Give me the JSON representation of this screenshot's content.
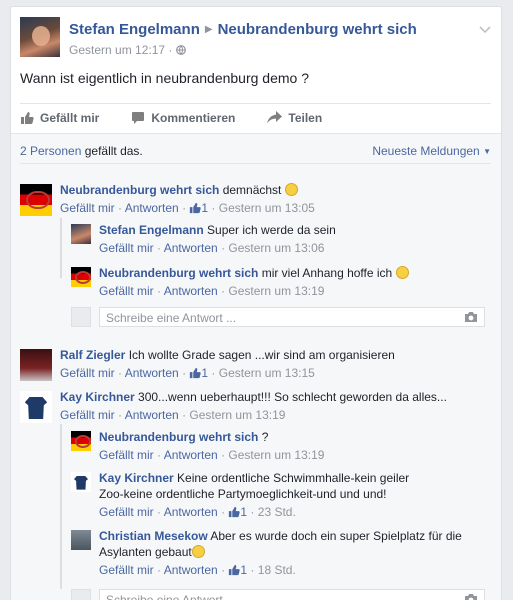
{
  "post": {
    "author": "Stefan Engelmann",
    "group": "Neubrandenburg wehrt sich",
    "timestamp": "Gestern um 12:17 · ",
    "text": "Wann ist eigentlich in neubrandenburg demo ?"
  },
  "actions": {
    "like": "Gefällt mir",
    "comment": "Kommentieren",
    "share": "Teilen"
  },
  "likes": {
    "count_text": "2 Personen",
    "suffix": " gefällt das.",
    "sort": "Neueste Meldungen"
  },
  "comments": [
    {
      "author": "Neubrandenburg wehrt sich",
      "text": " demnächst",
      "like": "Gefällt mir",
      "reply": "Antworten",
      "likes": "1",
      "time": "Gestern um 13:05"
    },
    {
      "author": "Stefan Engelmann",
      "text": " Super ich werde da sein",
      "like": "Gefällt mir",
      "reply": "Antworten",
      "time": "Gestern um 13:06"
    },
    {
      "author": "Neubrandenburg wehrt sich",
      "text": " mir viel Anhang hoffe ich",
      "like": "Gefällt mir",
      "reply": "Antworten",
      "time": "Gestern um 13:19"
    },
    {
      "author": "Ralf Ziegler",
      "text": " Ich wollte Grade sagen ...wir sind am organisieren",
      "like": "Gefällt mir",
      "reply": "Antworten",
      "likes": "1",
      "time": "Gestern um 13:15"
    },
    {
      "author": "Kay Kirchner",
      "text": " 300...wenn ueberhaupt!!! So schlecht geworden da alles...",
      "like": "Gefällt mir",
      "reply": "Antworten",
      "time": "Gestern um 13:19"
    },
    {
      "author": "Neubrandenburg wehrt sich",
      "text": " ?",
      "like": "Gefällt mir",
      "reply": "Antworten",
      "time": "Gestern um 13:19"
    },
    {
      "author": "Kay Kirchner",
      "text": " Keine ordentliche Schwimmhalle-kein geiler",
      "text2": "Zoo-keine ordentliche Partymoeglichkeit-und und und!",
      "like": "Gefällt mir",
      "reply": "Antworten",
      "likes": "1",
      "time": "23 Std."
    },
    {
      "author": "Christian Mesekow",
      "text": " Aber es wurde doch ein super Spielplatz für die",
      "text2": "Asylanten gebaut",
      "like": "Gefällt mir",
      "reply": "Antworten",
      "likes": "1",
      "time": "18 Std."
    }
  ],
  "reply_placeholder": "Schreibe eine Antwort ...",
  "colors": {
    "link": "#365899",
    "action_blue": "#4b67a1",
    "meta_gray": "#90949c",
    "background": "#e9ebee"
  },
  "icons": [
    "globe-icon",
    "thumbs-up-icon",
    "comment-icon",
    "share-icon",
    "camera-icon",
    "smiley-emoji",
    "laughing-emoji",
    "chevron-down-icon"
  ]
}
